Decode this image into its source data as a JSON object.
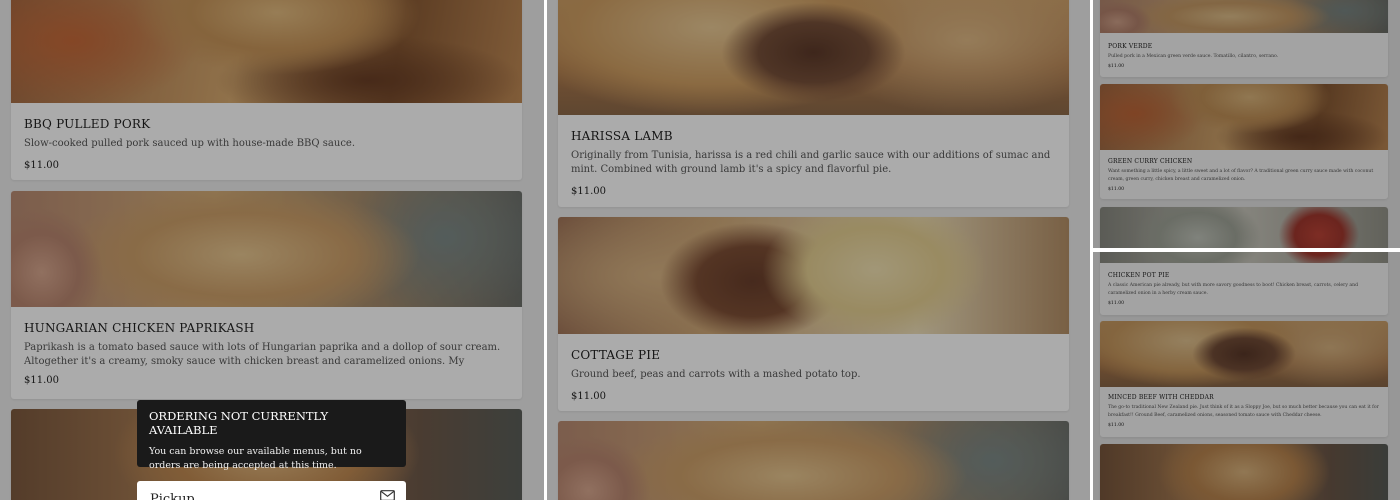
{
  "left_panel": {
    "items": [
      {
        "name": "BBQ PULLED PORK",
        "description": "Slow-cooked pulled pork sauced up with house-made BBQ sauce.",
        "price": "$11.00"
      },
      {
        "name": "HUNGARIAN CHICKEN PAPRIKASH",
        "description": "Paprikash is a tomato based sauce with lots of Hungarian paprika and a dollop of sour cream. Altogether it's a creamy, smoky sauce with chicken breast and caramelized onions. My Hungarian friend said it's al...",
        "price": "$11.00"
      }
    ]
  },
  "mid_panel": {
    "items": [
      {
        "name": "HARISSA LAMB",
        "description": "Originally from Tunisia, harissa is a red chili and garlic sauce with our additions of sumac and mint. Combined with ground lamb it's a spicy and flavorful pie.",
        "price": "$11.00"
      },
      {
        "name": "COTTAGE PIE",
        "description": "Ground beef, peas and carrots with a mashed potato top.",
        "price": "$11.00"
      }
    ]
  },
  "right_panel": {
    "items": [
      {
        "name": "PORK VERDE",
        "description": "Pulled pork in a Mexican green verde sauce. Tomatillo, cilantro, serrano.",
        "price": "$11.00"
      },
      {
        "name": "GREEN CURRY CHICKEN",
        "description": "Want something a little spicy, a little sweet and a lot of flavor? A traditional green curry sauce made with coconut cream, green curry, chicken breast and caramelized onion.",
        "price": "$11.00"
      },
      {
        "name": "CHICKEN POT PIE",
        "description": "A classic American pie already, but with more savory goodness to boot! Chicken breast, carrots, celery and caramelized onion in a herby cream sauce.",
        "price": "$11.00"
      },
      {
        "name": "MINCED BEEF WITH CHEDDAR",
        "description": "The go-to traditional New Zealand pie. Just think of it as a Sloppy Joe, but so much better because you can eat it for breakfast!! Ground Beef, caramelized onions, seasoned tomato sauce with Cheddar cheese.",
        "price": "$11.00"
      }
    ]
  },
  "notice": {
    "title": "ORDERING NOT CURRENTLY AVAILABLE",
    "body": "You can browse our available menus, but no orders are being accepted at this time."
  },
  "pickup": {
    "label": "Pickup",
    "icon": "mail-icon"
  },
  "colors": {
    "notice_bg": "#1a1a1a",
    "overlay": "rgba(0,0,0,0.33)"
  }
}
